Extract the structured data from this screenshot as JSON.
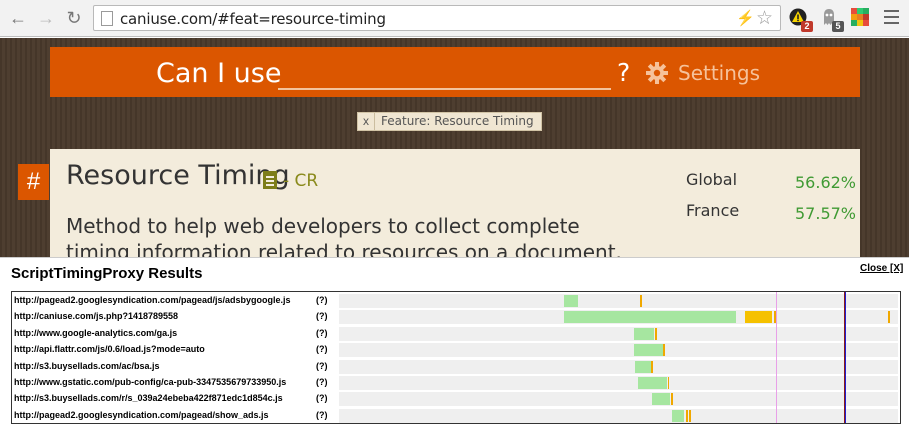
{
  "browser": {
    "url": "caniuse.com/#feat=resource-timing",
    "extensions": [
      {
        "icon": "warning-extension-icon",
        "badge": "2",
        "badge_color": "#c0392b"
      },
      {
        "icon": "ghostery-extension-icon",
        "badge": "5",
        "badge_color": "#555555"
      },
      {
        "icon": "colorful-grid-extension-icon",
        "badge": ""
      }
    ]
  },
  "header": {
    "title": "Can I use",
    "search_value": "",
    "help": "?",
    "settings_label": "Settings",
    "brand_color": "#db5600"
  },
  "filter": {
    "remove": "x",
    "label": "Feature: Resource Timing"
  },
  "feature": {
    "anchor": "#",
    "title": "Resource Timing",
    "status": "- CR",
    "description": "Method to help web developers to collect complete timing information related to resources on a document.",
    "usage": [
      {
        "label": "Global",
        "value": "56.62%"
      },
      {
        "label": "France",
        "value": "57.57%"
      }
    ]
  },
  "panel": {
    "title": "ScriptTimingProxy Results",
    "close": "Close [X]",
    "rows": [
      {
        "url": "http://pagead2.googlesyndication.com/pagead/js/adsbygoogle.js",
        "status": "(?)",
        "segments": [
          {
            "start": 0.403,
            "end": 0.428,
            "color": "#a6e6a0"
          },
          {
            "start": 0.539,
            "end": 0.542,
            "color": "#f0a800"
          }
        ]
      },
      {
        "url": "http://caniuse.com/js.php?1418789558",
        "status": "(?)",
        "segments": [
          {
            "start": 0.403,
            "end": 0.711,
            "color": "#a6e6a0"
          },
          {
            "start": 0.727,
            "end": 0.775,
            "color": "#f5c100"
          },
          {
            "start": 0.779,
            "end": 0.782,
            "color": "#f0a800"
          },
          {
            "start": 0.982,
            "end": 0.985,
            "color": "#f0a800"
          }
        ]
      },
      {
        "url": "http://www.google-analytics.com/ga.js",
        "status": "(?)",
        "segments": [
          {
            "start": 0.528,
            "end": 0.564,
            "color": "#a6e6a0"
          },
          {
            "start": 0.566,
            "end": 0.569,
            "color": "#f0a800"
          }
        ]
      },
      {
        "url": "http://api.flattr.com/js/0.6/load.js?mode=auto",
        "status": "(?)",
        "segments": [
          {
            "start": 0.528,
            "end": 0.579,
            "color": "#a6e6a0"
          },
          {
            "start": 0.58,
            "end": 0.583,
            "color": "#f0a800"
          }
        ]
      },
      {
        "url": "http://s3.buysellads.com/ac/bsa.js",
        "status": "(?)",
        "segments": [
          {
            "start": 0.53,
            "end": 0.558,
            "color": "#a6e6a0"
          },
          {
            "start": 0.559,
            "end": 0.562,
            "color": "#f0a800"
          }
        ]
      },
      {
        "url": "http://www.gstatic.com/pub-config/ca-pub-3347535679733950.js",
        "status": "(?)",
        "segments": [
          {
            "start": 0.535,
            "end": 0.586,
            "color": "#a6e6a0"
          },
          {
            "start": 0.588,
            "end": 0.591,
            "color": "#f0a800"
          }
        ]
      },
      {
        "url": "http://s3.buysellads.com/r/s_039a24ebeba422f871edc1d854c.js",
        "status": "(?)",
        "segments": [
          {
            "start": 0.56,
            "end": 0.592,
            "color": "#a6e6a0"
          },
          {
            "start": 0.594,
            "end": 0.597,
            "color": "#f0a800"
          }
        ]
      },
      {
        "url": "http://pagead2.googlesyndication.com/pagead/show_ads.js",
        "status": "(?)",
        "segments": [
          {
            "start": 0.595,
            "end": 0.618,
            "color": "#a6e6a0"
          },
          {
            "start": 0.621,
            "end": 0.624,
            "color": "#f0a800"
          },
          {
            "start": 0.627,
            "end": 0.63,
            "color": "#f0a800"
          }
        ]
      }
    ],
    "markers": [
      {
        "position": 0.781,
        "color": "#e8a0e8"
      },
      {
        "position": 0.904,
        "color": "#8b1a1a"
      },
      {
        "position": 0.906,
        "color": "#2020d0"
      }
    ]
  }
}
